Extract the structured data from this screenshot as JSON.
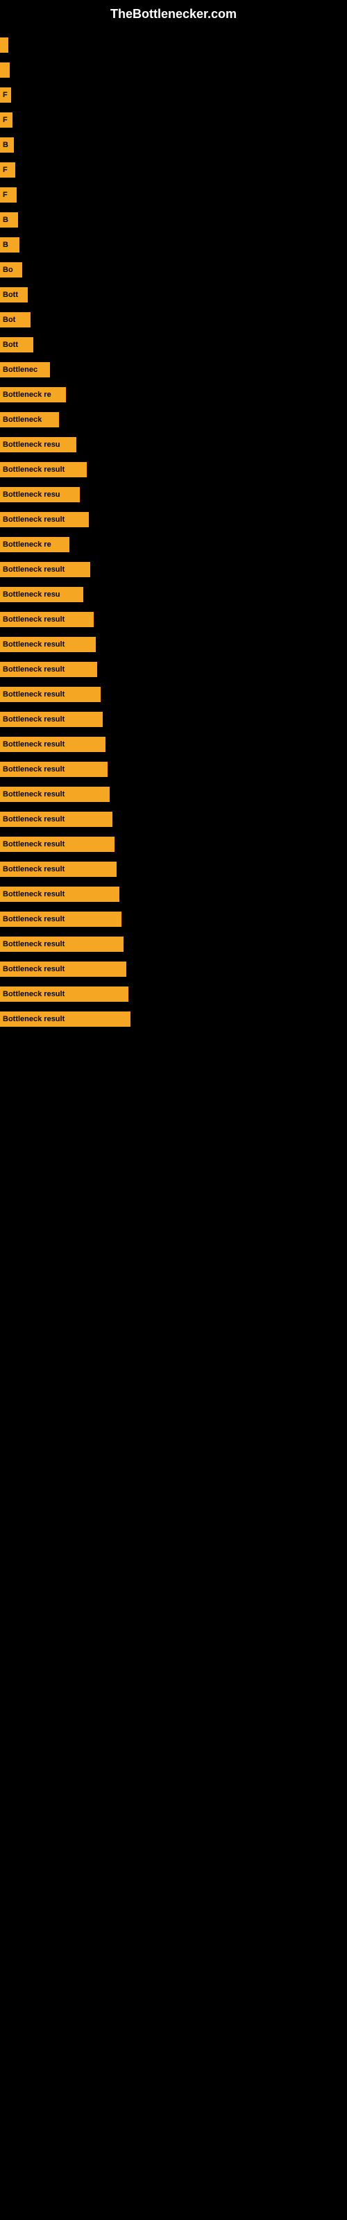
{
  "site": {
    "title": "TheBottlenecker.com"
  },
  "bars": [
    {
      "label": "",
      "width": 12
    },
    {
      "label": "",
      "width": 14
    },
    {
      "label": "F",
      "width": 16
    },
    {
      "label": "F",
      "width": 18
    },
    {
      "label": "B",
      "width": 20
    },
    {
      "label": "F",
      "width": 22
    },
    {
      "label": "F",
      "width": 24
    },
    {
      "label": "B",
      "width": 26
    },
    {
      "label": "B",
      "width": 28
    },
    {
      "label": "Bo",
      "width": 32
    },
    {
      "label": "Bott",
      "width": 40
    },
    {
      "label": "Bot",
      "width": 44
    },
    {
      "label": "Bott",
      "width": 48
    },
    {
      "label": "Bottlenec",
      "width": 72
    },
    {
      "label": "Bottleneck re",
      "width": 95
    },
    {
      "label": "Bottleneck",
      "width": 85
    },
    {
      "label": "Bottleneck resu",
      "width": 110
    },
    {
      "label": "Bottleneck result",
      "width": 125
    },
    {
      "label": "Bottleneck resu",
      "width": 115
    },
    {
      "label": "Bottleneck result",
      "width": 128
    },
    {
      "label": "Bottleneck re",
      "width": 100
    },
    {
      "label": "Bottleneck result",
      "width": 130
    },
    {
      "label": "Bottleneck resu",
      "width": 120
    },
    {
      "label": "Bottleneck result",
      "width": 135
    },
    {
      "label": "Bottleneck result",
      "width": 138
    },
    {
      "label": "Bottleneck result",
      "width": 140
    },
    {
      "label": "Bottleneck result",
      "width": 145
    },
    {
      "label": "Bottleneck result",
      "width": 148
    },
    {
      "label": "Bottleneck result",
      "width": 152
    },
    {
      "label": "Bottleneck result",
      "width": 155
    },
    {
      "label": "Bottleneck result",
      "width": 158
    },
    {
      "label": "Bottleneck result",
      "width": 162
    },
    {
      "label": "Bottleneck result",
      "width": 165
    },
    {
      "label": "Bottleneck result",
      "width": 168
    },
    {
      "label": "Bottleneck result",
      "width": 172
    },
    {
      "label": "Bottleneck result",
      "width": 175
    },
    {
      "label": "Bottleneck result",
      "width": 178
    },
    {
      "label": "Bottleneck result",
      "width": 182
    },
    {
      "label": "Bottleneck result",
      "width": 185
    },
    {
      "label": "Bottleneck result",
      "width": 188
    }
  ]
}
